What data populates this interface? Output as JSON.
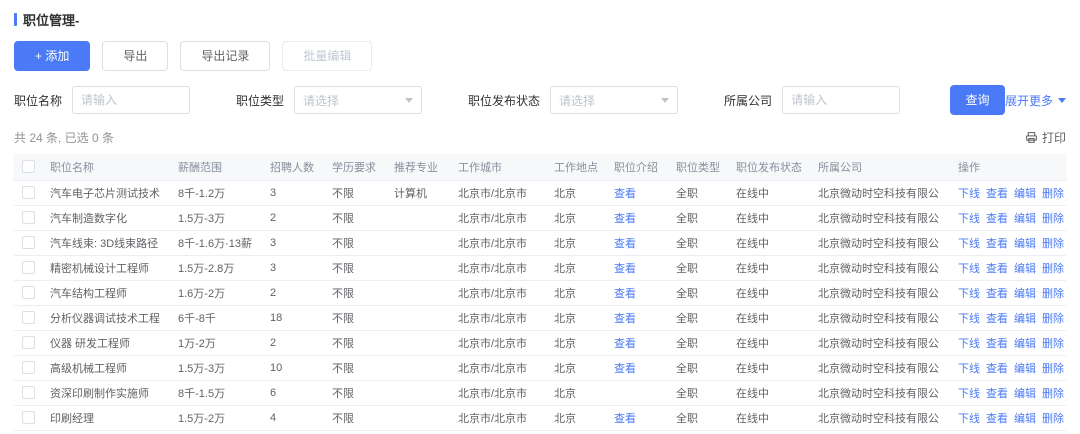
{
  "colors": {
    "primary": "#4a7af5"
  },
  "page_title": "职位管理-",
  "toolbar": {
    "add": "+ 添加",
    "export": "导出",
    "export_records": "导出记录",
    "batch_edit": "批量编辑"
  },
  "filters": {
    "job_name": {
      "label": "职位名称",
      "placeholder": "请输入"
    },
    "job_type": {
      "label": "职位类型",
      "placeholder": "请选择"
    },
    "publish_status": {
      "label": "职位发布状态",
      "placeholder": "请选择"
    },
    "company": {
      "label": "所属公司",
      "placeholder": "请输入"
    },
    "search": "查询",
    "expand_more": "展开更多"
  },
  "summary": {
    "count_text": "共 24 条, 已选 0 条",
    "print": "打印"
  },
  "table": {
    "columns": [
      "职位名称",
      "薪酬范围",
      "招聘人数",
      "学历要求",
      "推荐专业",
      "工作城市",
      "工作地点",
      "职位介绍",
      "职位类型",
      "职位发布状态",
      "所属公司",
      "操作"
    ],
    "intro_link": "查看",
    "actions": [
      "下线",
      "查看",
      "编辑",
      "删除"
    ],
    "rows": [
      {
        "name": "汽车电子芯片测试技术",
        "salary": "8千-1.2万",
        "count": "3",
        "edu": "不限",
        "major": "计算机",
        "city": "北京市/北京市",
        "location": "北京",
        "intro": "查看",
        "type": "全职",
        "status": "在线中",
        "company": "北京微动时空科技有限公"
      },
      {
        "name": "汽车制造数字化",
        "salary": "1.5万-3万",
        "count": "2",
        "edu": "不限",
        "major": "",
        "city": "北京市/北京市",
        "location": "北京",
        "intro": "查看",
        "type": "全职",
        "status": "在线中",
        "company": "北京微动时空科技有限公"
      },
      {
        "name": "汽车线束: 3D线束路径",
        "salary": "8千-1.6万·13薪",
        "count": "3",
        "edu": "不限",
        "major": "",
        "city": "北京市/北京市",
        "location": "北京",
        "intro": "查看",
        "type": "全职",
        "status": "在线中",
        "company": "北京微动时空科技有限公"
      },
      {
        "name": "精密机械设计工程师",
        "salary": "1.5万-2.8万",
        "count": "3",
        "edu": "不限",
        "major": "",
        "city": "北京市/北京市",
        "location": "北京",
        "intro": "查看",
        "type": "全职",
        "status": "在线中",
        "company": "北京微动时空科技有限公"
      },
      {
        "name": "汽车结构工程师",
        "salary": "1.6万-2万",
        "count": "2",
        "edu": "不限",
        "major": "",
        "city": "北京市/北京市",
        "location": "北京",
        "intro": "查看",
        "type": "全职",
        "status": "在线中",
        "company": "北京微动时空科技有限公"
      },
      {
        "name": "分析仪器调试技术工程",
        "salary": "6千-8千",
        "count": "18",
        "edu": "不限",
        "major": "",
        "city": "北京市/北京市",
        "location": "北京",
        "intro": "查看",
        "type": "全职",
        "status": "在线中",
        "company": "北京微动时空科技有限公"
      },
      {
        "name": "仪器 研发工程师",
        "salary": "1万-2万",
        "count": "2",
        "edu": "不限",
        "major": "",
        "city": "北京市/北京市",
        "location": "北京",
        "intro": "查看",
        "type": "全职",
        "status": "在线中",
        "company": "北京微动时空科技有限公"
      },
      {
        "name": "高级机械工程师",
        "salary": "1.5万-3万",
        "count": "10",
        "edu": "不限",
        "major": "",
        "city": "北京市/北京市",
        "location": "北京",
        "intro": "查看",
        "type": "全职",
        "status": "在线中",
        "company": "北京微动时空科技有限公"
      },
      {
        "name": "资深印刷制作实施师",
        "salary": "8千-1.5万",
        "count": "6",
        "edu": "不限",
        "major": "",
        "city": "北京市/北京市",
        "location": "北京",
        "intro": "",
        "type": "全职",
        "status": "在线中",
        "company": "北京微动时空科技有限公"
      },
      {
        "name": "印刷经理",
        "salary": "1.5万-2万",
        "count": "4",
        "edu": "不限",
        "major": "",
        "city": "北京市/北京市",
        "location": "北京",
        "intro": "查看",
        "type": "全职",
        "status": "在线中",
        "company": "北京微动时空科技有限公"
      }
    ]
  }
}
